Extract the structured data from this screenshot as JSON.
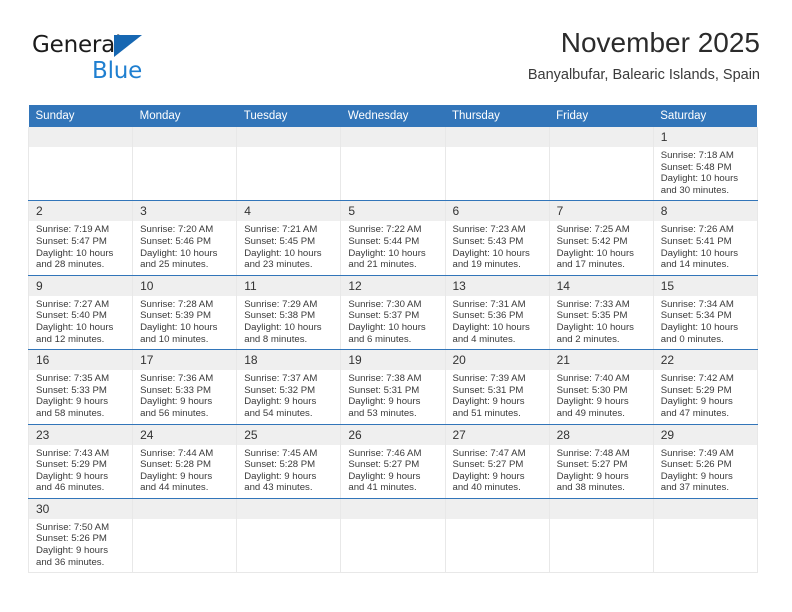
{
  "logo": {
    "word_one": "General",
    "word_two": "Blue",
    "triangle_color": "#1667b2",
    "blue_color": "#1f7fd0"
  },
  "header": {
    "title": "November 2025",
    "subtitle": "Banyalbufar, Balearic Islands, Spain"
  },
  "theme": {
    "header_blue": "#3275b9",
    "daynum_band": "#efefef",
    "text": "#333333"
  },
  "weekday_headers": [
    "Sunday",
    "Monday",
    "Tuesday",
    "Wednesday",
    "Thursday",
    "Friday",
    "Saturday"
  ],
  "weeks": [
    [
      {
        "day": "",
        "sunrise": "",
        "sunset": "",
        "daylight_line1": "",
        "daylight_line2": ""
      },
      {
        "day": "",
        "sunrise": "",
        "sunset": "",
        "daylight_line1": "",
        "daylight_line2": ""
      },
      {
        "day": "",
        "sunrise": "",
        "sunset": "",
        "daylight_line1": "",
        "daylight_line2": ""
      },
      {
        "day": "",
        "sunrise": "",
        "sunset": "",
        "daylight_line1": "",
        "daylight_line2": ""
      },
      {
        "day": "",
        "sunrise": "",
        "sunset": "",
        "daylight_line1": "",
        "daylight_line2": ""
      },
      {
        "day": "",
        "sunrise": "",
        "sunset": "",
        "daylight_line1": "",
        "daylight_line2": ""
      },
      {
        "day": "1",
        "sunrise": "Sunrise: 7:18 AM",
        "sunset": "Sunset: 5:48 PM",
        "daylight_line1": "Daylight: 10 hours",
        "daylight_line2": "and 30 minutes."
      }
    ],
    [
      {
        "day": "2",
        "sunrise": "Sunrise: 7:19 AM",
        "sunset": "Sunset: 5:47 PM",
        "daylight_line1": "Daylight: 10 hours",
        "daylight_line2": "and 28 minutes."
      },
      {
        "day": "3",
        "sunrise": "Sunrise: 7:20 AM",
        "sunset": "Sunset: 5:46 PM",
        "daylight_line1": "Daylight: 10 hours",
        "daylight_line2": "and 25 minutes."
      },
      {
        "day": "4",
        "sunrise": "Sunrise: 7:21 AM",
        "sunset": "Sunset: 5:45 PM",
        "daylight_line1": "Daylight: 10 hours",
        "daylight_line2": "and 23 minutes."
      },
      {
        "day": "5",
        "sunrise": "Sunrise: 7:22 AM",
        "sunset": "Sunset: 5:44 PM",
        "daylight_line1": "Daylight: 10 hours",
        "daylight_line2": "and 21 minutes."
      },
      {
        "day": "6",
        "sunrise": "Sunrise: 7:23 AM",
        "sunset": "Sunset: 5:43 PM",
        "daylight_line1": "Daylight: 10 hours",
        "daylight_line2": "and 19 minutes."
      },
      {
        "day": "7",
        "sunrise": "Sunrise: 7:25 AM",
        "sunset": "Sunset: 5:42 PM",
        "daylight_line1": "Daylight: 10 hours",
        "daylight_line2": "and 17 minutes."
      },
      {
        "day": "8",
        "sunrise": "Sunrise: 7:26 AM",
        "sunset": "Sunset: 5:41 PM",
        "daylight_line1": "Daylight: 10 hours",
        "daylight_line2": "and 14 minutes."
      }
    ],
    [
      {
        "day": "9",
        "sunrise": "Sunrise: 7:27 AM",
        "sunset": "Sunset: 5:40 PM",
        "daylight_line1": "Daylight: 10 hours",
        "daylight_line2": "and 12 minutes."
      },
      {
        "day": "10",
        "sunrise": "Sunrise: 7:28 AM",
        "sunset": "Sunset: 5:39 PM",
        "daylight_line1": "Daylight: 10 hours",
        "daylight_line2": "and 10 minutes."
      },
      {
        "day": "11",
        "sunrise": "Sunrise: 7:29 AM",
        "sunset": "Sunset: 5:38 PM",
        "daylight_line1": "Daylight: 10 hours",
        "daylight_line2": "and 8 minutes."
      },
      {
        "day": "12",
        "sunrise": "Sunrise: 7:30 AM",
        "sunset": "Sunset: 5:37 PM",
        "daylight_line1": "Daylight: 10 hours",
        "daylight_line2": "and 6 minutes."
      },
      {
        "day": "13",
        "sunrise": "Sunrise: 7:31 AM",
        "sunset": "Sunset: 5:36 PM",
        "daylight_line1": "Daylight: 10 hours",
        "daylight_line2": "and 4 minutes."
      },
      {
        "day": "14",
        "sunrise": "Sunrise: 7:33 AM",
        "sunset": "Sunset: 5:35 PM",
        "daylight_line1": "Daylight: 10 hours",
        "daylight_line2": "and 2 minutes."
      },
      {
        "day": "15",
        "sunrise": "Sunrise: 7:34 AM",
        "sunset": "Sunset: 5:34 PM",
        "daylight_line1": "Daylight: 10 hours",
        "daylight_line2": "and 0 minutes."
      }
    ],
    [
      {
        "day": "16",
        "sunrise": "Sunrise: 7:35 AM",
        "sunset": "Sunset: 5:33 PM",
        "daylight_line1": "Daylight: 9 hours",
        "daylight_line2": "and 58 minutes."
      },
      {
        "day": "17",
        "sunrise": "Sunrise: 7:36 AM",
        "sunset": "Sunset: 5:33 PM",
        "daylight_line1": "Daylight: 9 hours",
        "daylight_line2": "and 56 minutes."
      },
      {
        "day": "18",
        "sunrise": "Sunrise: 7:37 AM",
        "sunset": "Sunset: 5:32 PM",
        "daylight_line1": "Daylight: 9 hours",
        "daylight_line2": "and 54 minutes."
      },
      {
        "day": "19",
        "sunrise": "Sunrise: 7:38 AM",
        "sunset": "Sunset: 5:31 PM",
        "daylight_line1": "Daylight: 9 hours",
        "daylight_line2": "and 53 minutes."
      },
      {
        "day": "20",
        "sunrise": "Sunrise: 7:39 AM",
        "sunset": "Sunset: 5:31 PM",
        "daylight_line1": "Daylight: 9 hours",
        "daylight_line2": "and 51 minutes."
      },
      {
        "day": "21",
        "sunrise": "Sunrise: 7:40 AM",
        "sunset": "Sunset: 5:30 PM",
        "daylight_line1": "Daylight: 9 hours",
        "daylight_line2": "and 49 minutes."
      },
      {
        "day": "22",
        "sunrise": "Sunrise: 7:42 AM",
        "sunset": "Sunset: 5:29 PM",
        "daylight_line1": "Daylight: 9 hours",
        "daylight_line2": "and 47 minutes."
      }
    ],
    [
      {
        "day": "23",
        "sunrise": "Sunrise: 7:43 AM",
        "sunset": "Sunset: 5:29 PM",
        "daylight_line1": "Daylight: 9 hours",
        "daylight_line2": "and 46 minutes."
      },
      {
        "day": "24",
        "sunrise": "Sunrise: 7:44 AM",
        "sunset": "Sunset: 5:28 PM",
        "daylight_line1": "Daylight: 9 hours",
        "daylight_line2": "and 44 minutes."
      },
      {
        "day": "25",
        "sunrise": "Sunrise: 7:45 AM",
        "sunset": "Sunset: 5:28 PM",
        "daylight_line1": "Daylight: 9 hours",
        "daylight_line2": "and 43 minutes."
      },
      {
        "day": "26",
        "sunrise": "Sunrise: 7:46 AM",
        "sunset": "Sunset: 5:27 PM",
        "daylight_line1": "Daylight: 9 hours",
        "daylight_line2": "and 41 minutes."
      },
      {
        "day": "27",
        "sunrise": "Sunrise: 7:47 AM",
        "sunset": "Sunset: 5:27 PM",
        "daylight_line1": "Daylight: 9 hours",
        "daylight_line2": "and 40 minutes."
      },
      {
        "day": "28",
        "sunrise": "Sunrise: 7:48 AM",
        "sunset": "Sunset: 5:27 PM",
        "daylight_line1": "Daylight: 9 hours",
        "daylight_line2": "and 38 minutes."
      },
      {
        "day": "29",
        "sunrise": "Sunrise: 7:49 AM",
        "sunset": "Sunset: 5:26 PM",
        "daylight_line1": "Daylight: 9 hours",
        "daylight_line2": "and 37 minutes."
      }
    ],
    [
      {
        "day": "30",
        "sunrise": "Sunrise: 7:50 AM",
        "sunset": "Sunset: 5:26 PM",
        "daylight_line1": "Daylight: 9 hours",
        "daylight_line2": "and 36 minutes."
      },
      {
        "day": "",
        "sunrise": "",
        "sunset": "",
        "daylight_line1": "",
        "daylight_line2": ""
      },
      {
        "day": "",
        "sunrise": "",
        "sunset": "",
        "daylight_line1": "",
        "daylight_line2": ""
      },
      {
        "day": "",
        "sunrise": "",
        "sunset": "",
        "daylight_line1": "",
        "daylight_line2": ""
      },
      {
        "day": "",
        "sunrise": "",
        "sunset": "",
        "daylight_line1": "",
        "daylight_line2": ""
      },
      {
        "day": "",
        "sunrise": "",
        "sunset": "",
        "daylight_line1": "",
        "daylight_line2": ""
      },
      {
        "day": "",
        "sunrise": "",
        "sunset": "",
        "daylight_line1": "",
        "daylight_line2": ""
      }
    ]
  ]
}
